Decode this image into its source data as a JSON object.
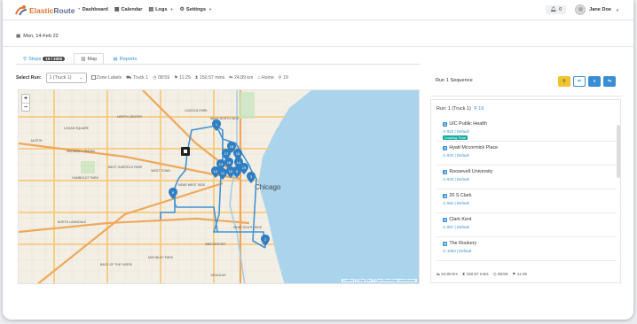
{
  "app": {
    "name_a": "Elastic",
    "name_b": "Route"
  },
  "nav": [
    {
      "label": "Dashboard",
      "icon": "dashboard-icon",
      "glyph": "⚙",
      "dropdown": false
    },
    {
      "label": "Calendar",
      "icon": "calendar-icon",
      "glyph": "▦",
      "dropdown": false
    },
    {
      "label": "Logs",
      "icon": "document-icon",
      "glyph": "▤",
      "dropdown": true
    },
    {
      "label": "Settings",
      "icon": "sliders-icon",
      "glyph": "⚙",
      "dropdown": true
    }
  ],
  "notifications": {
    "count": "0"
  },
  "user": {
    "name": "Jane Doe"
  },
  "date": "Mon, 14-Feb 22",
  "tabs": [
    {
      "label": "Stops",
      "badge": "19 / 2000"
    },
    {
      "label": "Map"
    },
    {
      "label": "Reports"
    }
  ],
  "run_info": {
    "select_label": "Select Run:",
    "selected": "1 (Truck 1)",
    "zone_labels": "Zone Labels",
    "truck": "Truck 1",
    "start": "08:59",
    "end": "11:29",
    "duration": "150.57 mins",
    "distance": "24.89 km",
    "home": "Home",
    "stops": "19"
  },
  "map": {
    "labels": [
      "Chicago",
      "EDGE WATER",
      "UPTOWN",
      "NEAR NORTH SIDE",
      "NORTH CENTER",
      "LINCOLN PARK",
      "LOGAN SQUARE",
      "WEST TOWN",
      "WEST GARFIELD PARK",
      "NORTH LAWNDALE",
      "NEAR WEST SIDE",
      "NEAR SOUTH SIDE",
      "BRIDGEPORT",
      "MCKINLEY PARK",
      "BACK OF THE YARDS",
      "ARCHER HEIGHTS",
      "BRIGHTON PARK",
      "HERMOSA",
      "AUSTIN",
      "BELMONT CRAGIN",
      "HUMBOLDT PARK",
      "GRAND BOULEVARD",
      "ROSELAND",
      "KENWOOD",
      "LITTLE VILLAGE",
      "PORTAGE PARK",
      "DOUGLAS"
    ],
    "attribution": "Leaflet | © MapTiler © OpenStreetMap contributors",
    "markers": [
      "1",
      "2",
      "3",
      "5",
      "8",
      "10",
      "11",
      "12",
      "13",
      "14",
      "15",
      "16",
      "17",
      "18",
      "19"
    ]
  },
  "sequence": {
    "title": "Run 1 Sequence",
    "run_header": "Run: 1 (Truck 1)",
    "stop_count": "19",
    "stops": [
      {
        "n": "1",
        "name": "UIC Public Health",
        "meta": "⊙ 922 | Default",
        "tag": "Loading Time"
      },
      {
        "n": "2",
        "name": "Hyatt Mccormick Place",
        "meta": "⊙ 934 | Default"
      },
      {
        "n": "3",
        "name": "Roosevelt University",
        "meta": "⊙ 943 | Default"
      },
      {
        "n": "4",
        "name": "20 S Clark",
        "meta": "⊙ 952 | Default"
      },
      {
        "n": "5",
        "name": "Clark Kent",
        "meta": "⊙ 957 | Default"
      },
      {
        "n": "6",
        "name": "The Rookery",
        "meta": "⊙ 1003 | Default"
      }
    ],
    "stats": {
      "distance": "24.89 km",
      "duration": "150.57 mins",
      "start": "08:59",
      "end": "11:29"
    }
  },
  "colors": {
    "accent": "#3a8fd3",
    "logo": "#e3742f",
    "water": "#a9d3ea",
    "road": "#f6c87a",
    "tag": "#18a9a0"
  }
}
